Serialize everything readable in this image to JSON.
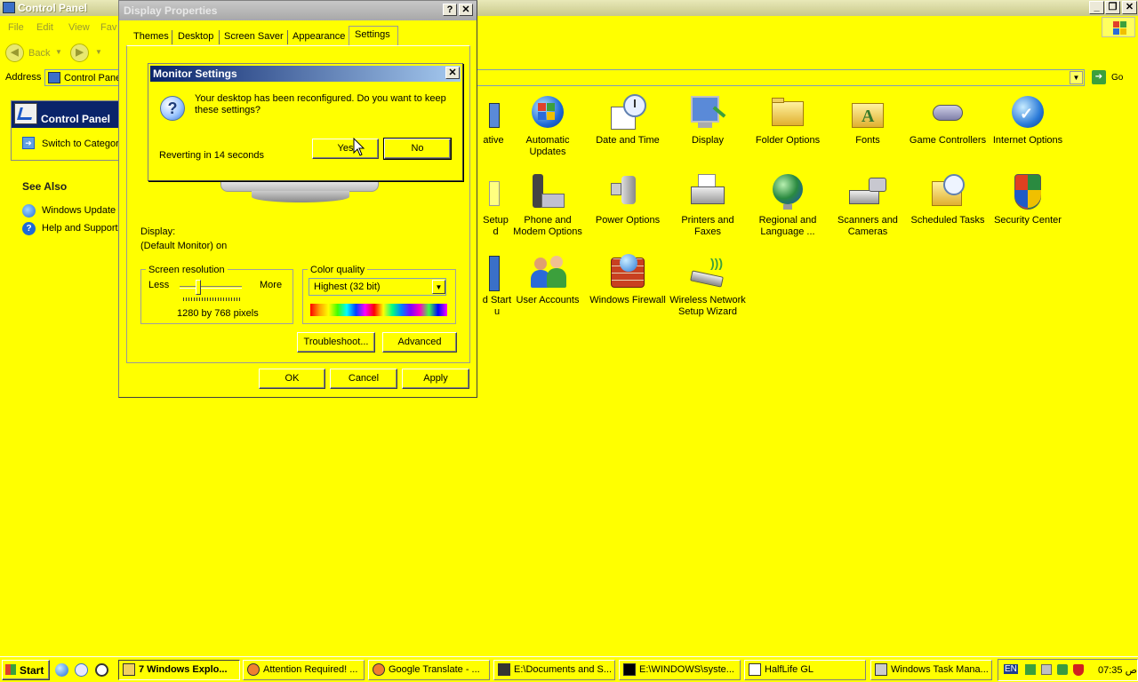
{
  "control_panel": {
    "title": "Control Panel",
    "menu": [
      "File",
      "Edit",
      "View",
      "Fav"
    ],
    "toolbar": {
      "back_label": "Back"
    },
    "address": {
      "label": "Address",
      "value": "Control Panel",
      "go_label": "Go"
    },
    "task_pane": {
      "title": "Control Panel",
      "switch_label": "Switch to Categor",
      "see_also_title": "See Also",
      "see_also_links": [
        "Windows Update",
        "Help and Support"
      ]
    },
    "items": [
      {
        "label_1": "ative",
        "label_2": ""
      },
      {
        "label_1": "Automatic",
        "label_2": "Updates"
      },
      {
        "label_1": "Date and Time",
        "label_2": ""
      },
      {
        "label_1": "Display",
        "label_2": ""
      },
      {
        "label_1": "Folder Options",
        "label_2": ""
      },
      {
        "label_1": "Fonts",
        "label_2": ""
      },
      {
        "label_1": "Game Controllers",
        "label_2": ""
      },
      {
        "label_1": "Internet Options",
        "label_2": ""
      },
      {
        "label_1": "Setup",
        "label_2": "d"
      },
      {
        "label_1": "Phone and",
        "label_2": "Modem Options"
      },
      {
        "label_1": "Power Options",
        "label_2": ""
      },
      {
        "label_1": "Printers and",
        "label_2": "Faxes"
      },
      {
        "label_1": "Regional and",
        "label_2": "Language ..."
      },
      {
        "label_1": "Scanners and",
        "label_2": "Cameras"
      },
      {
        "label_1": "Scheduled Tasks",
        "label_2": ""
      },
      {
        "label_1": "Security Center",
        "label_2": ""
      },
      {
        "label_1": "d Start",
        "label_2": "u"
      },
      {
        "label_1": "User Accounts",
        "label_2": ""
      },
      {
        "label_1": "Windows Firewall",
        "label_2": ""
      },
      {
        "label_1": "Wireless Network",
        "label_2": "Setup Wizard"
      }
    ]
  },
  "display_properties": {
    "title": "Display Properties",
    "help_glyph": "?",
    "close_glyph": "✕",
    "tabs": [
      "Themes",
      "Desktop",
      "Screen Saver",
      "Appearance",
      "Settings"
    ],
    "display_label": "Display:",
    "display_value": "(Default Monitor) on",
    "resolution": {
      "title": "Screen resolution",
      "less": "Less",
      "more": "More",
      "value": "1280 by 768 pixels",
      "slider_position": 0.3
    },
    "color_quality": {
      "title": "Color quality",
      "value": "Highest (32 bit)"
    },
    "troubleshoot_label": "Troubleshoot...",
    "advanced_label": "Advanced",
    "ok_label": "OK",
    "cancel_label": "Cancel",
    "apply_label": "Apply"
  },
  "monitor_settings": {
    "title": "Monitor Settings",
    "close_glyph": "✕",
    "message_line1": "Your desktop has been reconfigured.  Do you want to keep",
    "message_line2": "these settings?",
    "countdown": "Reverting in 14 seconds",
    "yes_label": "Yes",
    "no_label": "No"
  },
  "taskbar": {
    "start_label": "Start",
    "tasks": [
      {
        "label": "7 Windows Explo...",
        "active": true
      },
      {
        "label": "Attention Required! ...",
        "active": false
      },
      {
        "label": "Google Translate - ...",
        "active": false
      },
      {
        "label": "E:\\Documents and S...",
        "active": false
      },
      {
        "label": "E:\\WINDOWS\\syste...",
        "active": false
      },
      {
        "label": "HalfLife GL",
        "active": false
      },
      {
        "label": "Windows Task Mana...",
        "active": false
      }
    ],
    "language": "EN",
    "clock": "07:35 ص"
  }
}
